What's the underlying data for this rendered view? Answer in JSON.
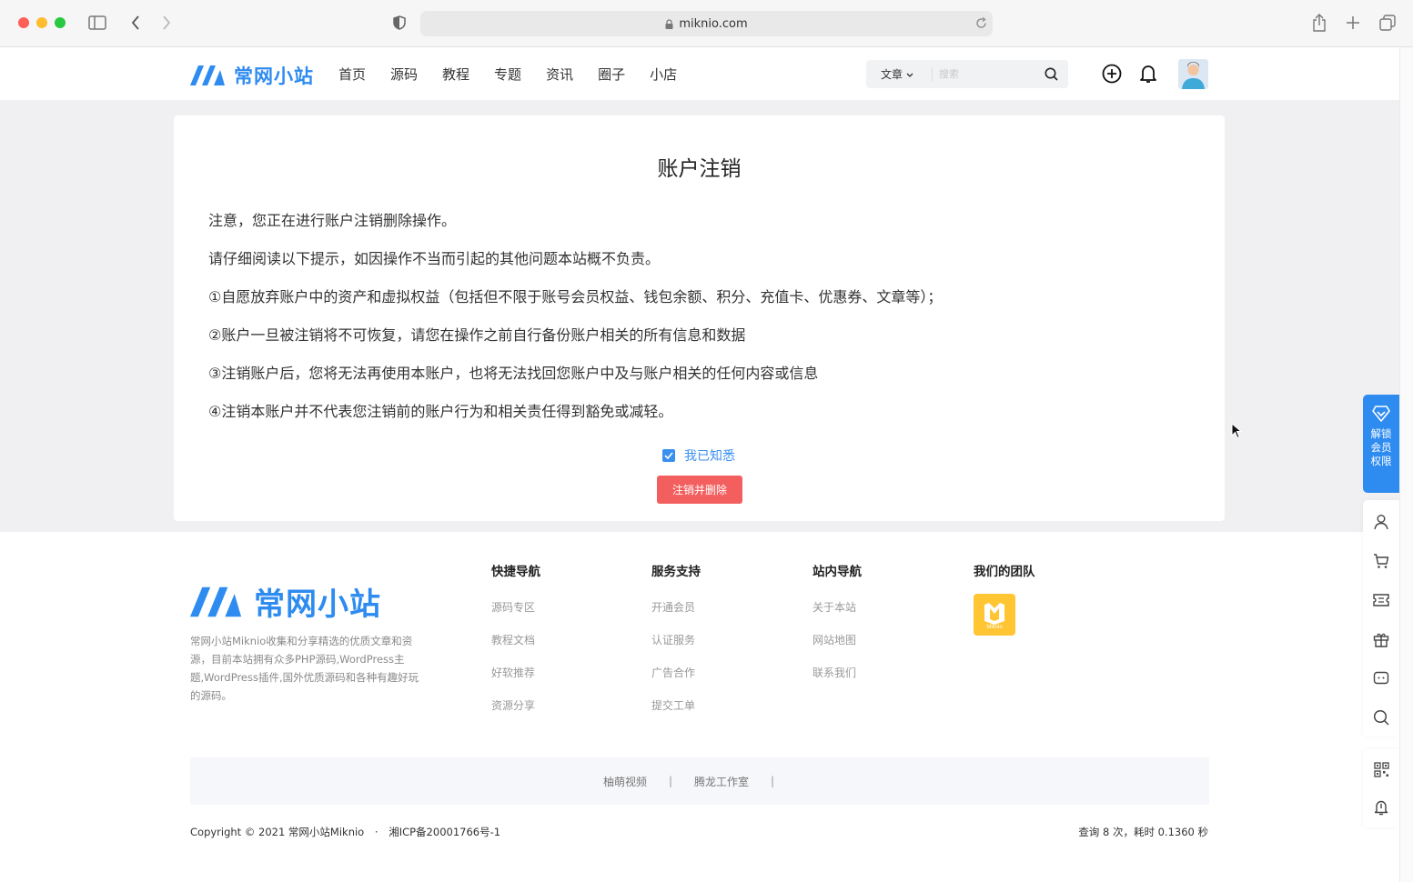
{
  "browser": {
    "url": "miknio.com"
  },
  "header": {
    "logo_text": "常网小站",
    "nav": [
      "首页",
      "源码",
      "教程",
      "专题",
      "资讯",
      "圈子",
      "小店"
    ],
    "search_type": "文章",
    "search_placeholder": "搜索"
  },
  "main": {
    "title": "账户注销",
    "paragraphs": [
      "注意，您正在进行账户注销删除操作。",
      "请仔细阅读以下提示，如因操作不当而引起的其他问题本站概不负责。",
      "①自愿放弃账户中的资产和虚拟权益（包括但不限于账号会员权益、钱包余额、积分、充值卡、优惠券、文章等）；",
      "②账户一旦被注销将不可恢复，请您在操作之前自行备份账户相关的所有信息和数据",
      "③注销账户后，您将无法再使用本账户，也将无法找回您账户中及与账户相关的任何内容或信息",
      "④注销本账户并不代表您注销前的账户行为和相关责任得到豁免或减轻。"
    ],
    "agree_label": "我已知悉",
    "agree_checked": true,
    "delete_button": "注销并删除"
  },
  "footer": {
    "logo_text": "常网小站",
    "description": "常网小站Miknio收集和分享精选的优质文章和资源，目前本站拥有众多PHP源码,WordPress主题,WordPress插件,国外优质源码和各种有趣好玩的源码。",
    "columns": [
      {
        "title": "快捷导航",
        "links": [
          "源码专区",
          "教程文档",
          "好软推荐",
          "资源分享"
        ]
      },
      {
        "title": "服务支持",
        "links": [
          "开通会员",
          "认证服务",
          "广告合作",
          "提交工单"
        ]
      },
      {
        "title": "站内导航",
        "links": [
          "关于本站",
          "网站地图",
          "联系我们"
        ]
      },
      {
        "title": "我们的团队",
        "links": []
      }
    ],
    "team_logo_text": "Miknio",
    "friend_links": [
      "柚萌视频",
      "腾龙工作室"
    ],
    "friend_sep": "|",
    "copyright": "Copyright © 2021 常网小站Miknio",
    "dot": "·",
    "icp": "湘ICP备20001766号-1",
    "stats": "查询 8 次，耗时 0.1360 秒"
  },
  "sidebar": {
    "vip_label": "解锁会员权限"
  },
  "colors": {
    "brand": "#2e8bf0",
    "danger": "#f35f5f",
    "team": "#ffc533"
  }
}
